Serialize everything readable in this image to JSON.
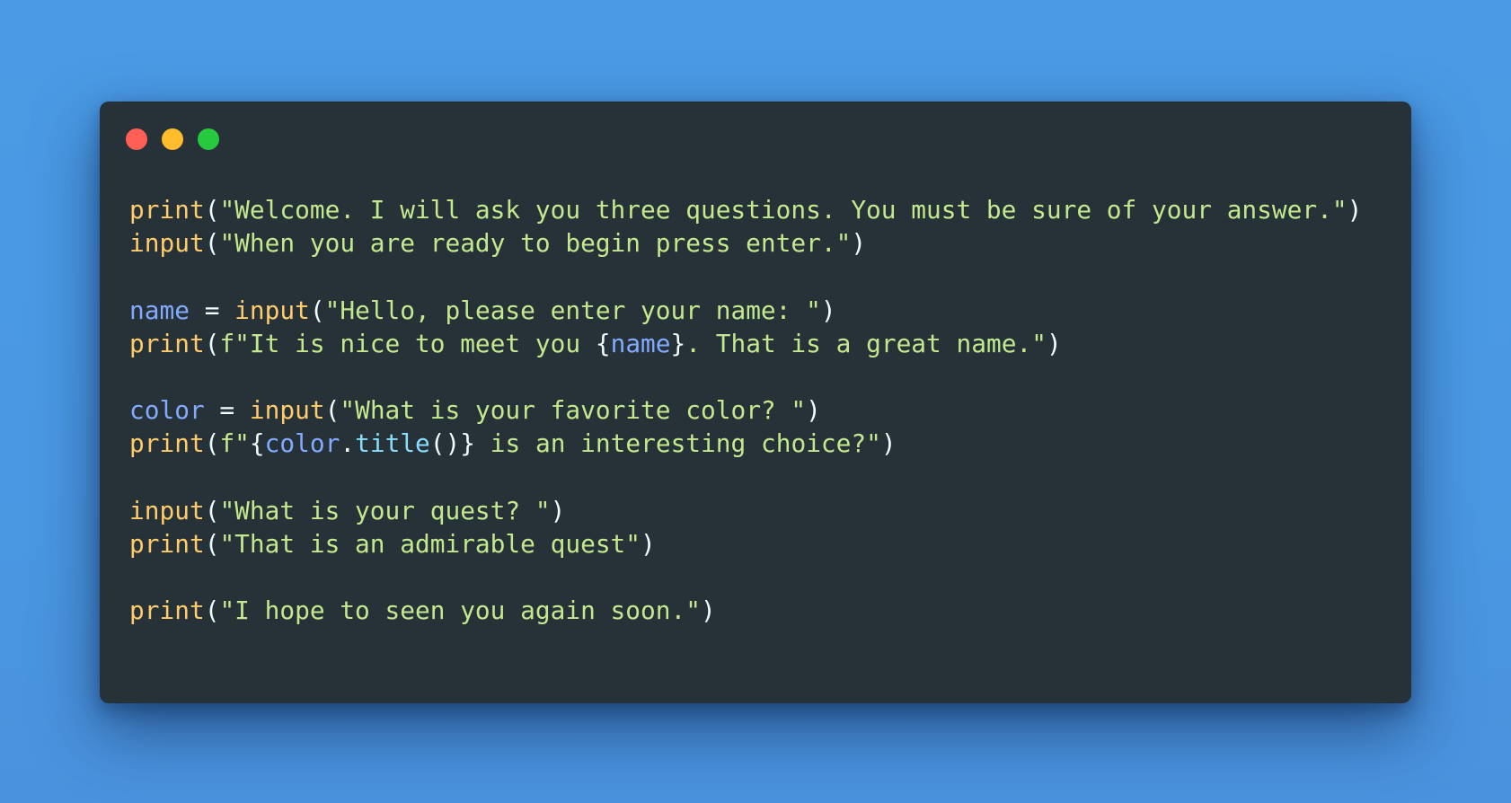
{
  "colors": {
    "background": "#4a9be6",
    "editor_background": "#263238",
    "close_dot": "#ff5f56",
    "minimize_dot": "#ffbd2e",
    "maximize_dot": "#27c93f",
    "function": "#ffcb6b",
    "string": "#c3e88d",
    "variable": "#82aaff",
    "method": "#89ddff",
    "punctuation": "#eeffff"
  },
  "window_controls": [
    {
      "name": "close-dot",
      "color": "#ff5f56"
    },
    {
      "name": "minimize-dot",
      "color": "#ffbd2e"
    },
    {
      "name": "maximize-dot",
      "color": "#27c93f"
    }
  ],
  "code_lines": [
    [
      {
        "t": "fn",
        "v": "print"
      },
      {
        "t": "punct",
        "v": "("
      },
      {
        "t": "str",
        "v": "\"Welcome. I will ask you three questions. You must be sure of your answer.\""
      },
      {
        "t": "punct",
        "v": ")"
      }
    ],
    [
      {
        "t": "fn",
        "v": "input"
      },
      {
        "t": "punct",
        "v": "("
      },
      {
        "t": "str",
        "v": "\"When you are ready to begin press enter.\""
      },
      {
        "t": "punct",
        "v": ")"
      }
    ],
    [],
    [
      {
        "t": "var",
        "v": "name"
      },
      {
        "t": "punct",
        "v": " = "
      },
      {
        "t": "fn",
        "v": "input"
      },
      {
        "t": "punct",
        "v": "("
      },
      {
        "t": "str",
        "v": "\"Hello, please enter your name: \""
      },
      {
        "t": "punct",
        "v": ")"
      }
    ],
    [
      {
        "t": "fn",
        "v": "print"
      },
      {
        "t": "punct",
        "v": "("
      },
      {
        "t": "str",
        "v": "f\"It is nice to meet you "
      },
      {
        "t": "punct",
        "v": "{"
      },
      {
        "t": "var",
        "v": "name"
      },
      {
        "t": "punct",
        "v": "}"
      },
      {
        "t": "str",
        "v": ". That is a great name.\""
      },
      {
        "t": "punct",
        "v": ")"
      }
    ],
    [],
    [
      {
        "t": "var",
        "v": "color"
      },
      {
        "t": "punct",
        "v": " = "
      },
      {
        "t": "fn",
        "v": "input"
      },
      {
        "t": "punct",
        "v": "("
      },
      {
        "t": "str",
        "v": "\"What is your favorite color? \""
      },
      {
        "t": "punct",
        "v": ")"
      }
    ],
    [
      {
        "t": "fn",
        "v": "print"
      },
      {
        "t": "punct",
        "v": "("
      },
      {
        "t": "str",
        "v": "f\""
      },
      {
        "t": "punct",
        "v": "{"
      },
      {
        "t": "var",
        "v": "color"
      },
      {
        "t": "punct",
        "v": "."
      },
      {
        "t": "method",
        "v": "title"
      },
      {
        "t": "punct",
        "v": "()}"
      },
      {
        "t": "str",
        "v": " is an interesting choice?\""
      },
      {
        "t": "punct",
        "v": ")"
      }
    ],
    [],
    [
      {
        "t": "fn",
        "v": "input"
      },
      {
        "t": "punct",
        "v": "("
      },
      {
        "t": "str",
        "v": "\"What is your quest? \""
      },
      {
        "t": "punct",
        "v": ")"
      }
    ],
    [
      {
        "t": "fn",
        "v": "print"
      },
      {
        "t": "punct",
        "v": "("
      },
      {
        "t": "str",
        "v": "\"That is an admirable quest\""
      },
      {
        "t": "punct",
        "v": ")"
      }
    ],
    [],
    [
      {
        "t": "fn",
        "v": "print"
      },
      {
        "t": "punct",
        "v": "("
      },
      {
        "t": "str",
        "v": "\"I hope to seen you again soon.\""
      },
      {
        "t": "punct",
        "v": ")"
      }
    ]
  ]
}
